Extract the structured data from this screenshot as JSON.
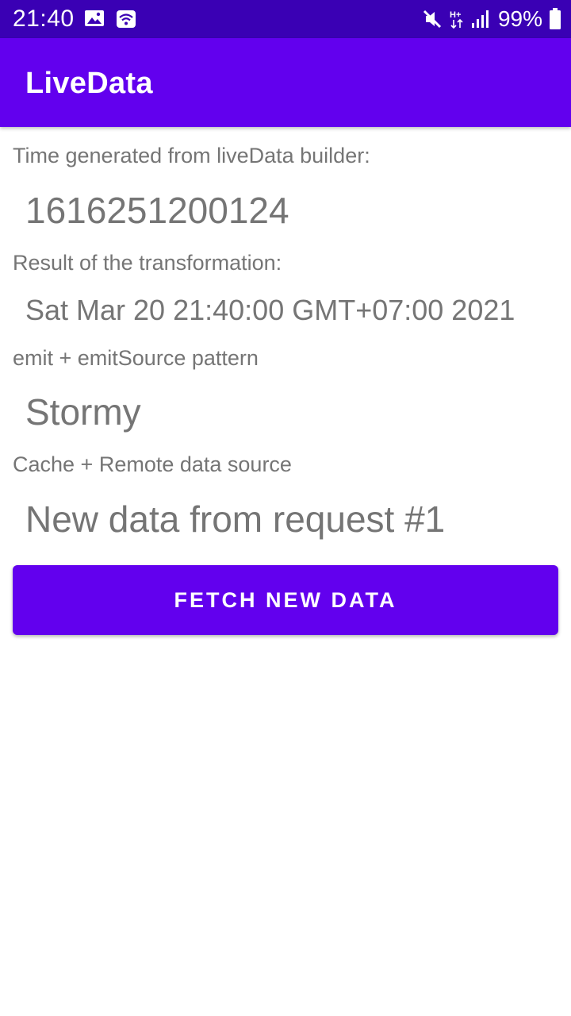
{
  "status_bar": {
    "time": "21:40",
    "battery_percent": "99%",
    "icons_left": [
      "image-icon",
      "wifi-icon"
    ],
    "icons_right": [
      "mute-icon",
      "hplus-data-icon",
      "signal-icon",
      "battery-icon"
    ]
  },
  "app_bar": {
    "title": "LiveData"
  },
  "sections": {
    "builder": {
      "label": "Time generated from liveData builder:",
      "value": "1616251200124"
    },
    "transformation": {
      "label": "Result of the transformation:",
      "value": "Sat Mar 20 21:40:00 GMT+07:00 2021"
    },
    "emit": {
      "label": "emit + emitSource pattern",
      "value": "Stormy"
    },
    "cache": {
      "label": "Cache + Remote data source",
      "value": "New data from request #1"
    }
  },
  "actions": {
    "fetch_label": "FETCH NEW DATA"
  },
  "colors": {
    "status_bar": "#3a00b4",
    "primary": "#6200ee",
    "text_secondary": "#757575"
  }
}
